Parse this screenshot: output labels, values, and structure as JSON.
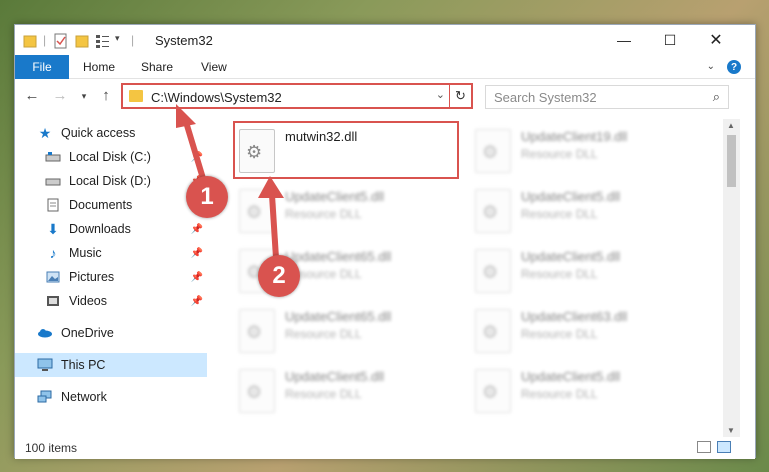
{
  "window": {
    "title": "System32"
  },
  "ribbon": {
    "file_tab": "File",
    "tabs": [
      "Home",
      "Share",
      "View"
    ],
    "help_label": "?"
  },
  "address_bar": {
    "path": "C:\\Windows\\System32"
  },
  "search": {
    "placeholder": "Search System32"
  },
  "sidebar": {
    "items": [
      {
        "label": "Quick access",
        "icon": "star-icon"
      },
      {
        "label": "Local Disk (C:)",
        "icon": "drive-icon"
      },
      {
        "label": "Local Disk (D:)",
        "icon": "drive-icon"
      },
      {
        "label": "Documents",
        "icon": "document-icon"
      },
      {
        "label": "Downloads",
        "icon": "download-icon"
      },
      {
        "label": "Music",
        "icon": "music-icon"
      },
      {
        "label": "Pictures",
        "icon": "pictures-icon"
      },
      {
        "label": "Videos",
        "icon": "video-icon"
      },
      {
        "label": "OneDrive",
        "icon": "cloud-icon"
      },
      {
        "label": "This PC",
        "icon": "computer-icon"
      },
      {
        "label": "Network",
        "icon": "network-icon"
      }
    ]
  },
  "files": [
    {
      "name": "mutwin32.dll",
      "type": ""
    },
    {
      "name": "UpdateClient19.dll",
      "type": "Resource DLL"
    },
    {
      "name": "UpdateClient5.dll",
      "type": "Resource DLL"
    },
    {
      "name": "UpdateClient5.dll",
      "type": "Resource DLL"
    },
    {
      "name": "UpdateClient65.dll",
      "type": "Resource DLL"
    },
    {
      "name": "UpdateClient5.dll",
      "type": "Resource DLL"
    },
    {
      "name": "UpdateClient65.dll",
      "type": "Resource DLL"
    },
    {
      "name": "UpdateClient63.dll",
      "type": "Resource DLL"
    },
    {
      "name": "UpdateClient5.dll",
      "type": "Resource DLL"
    },
    {
      "name": "UpdateClient5.dll",
      "type": "Resource DLL"
    }
  ],
  "status": {
    "item_count": "100 items"
  },
  "annotations": {
    "step1": "1",
    "step2": "2"
  },
  "colors": {
    "accent": "#1979ca",
    "highlight": "#d9534f",
    "selected": "#cce8ff"
  }
}
